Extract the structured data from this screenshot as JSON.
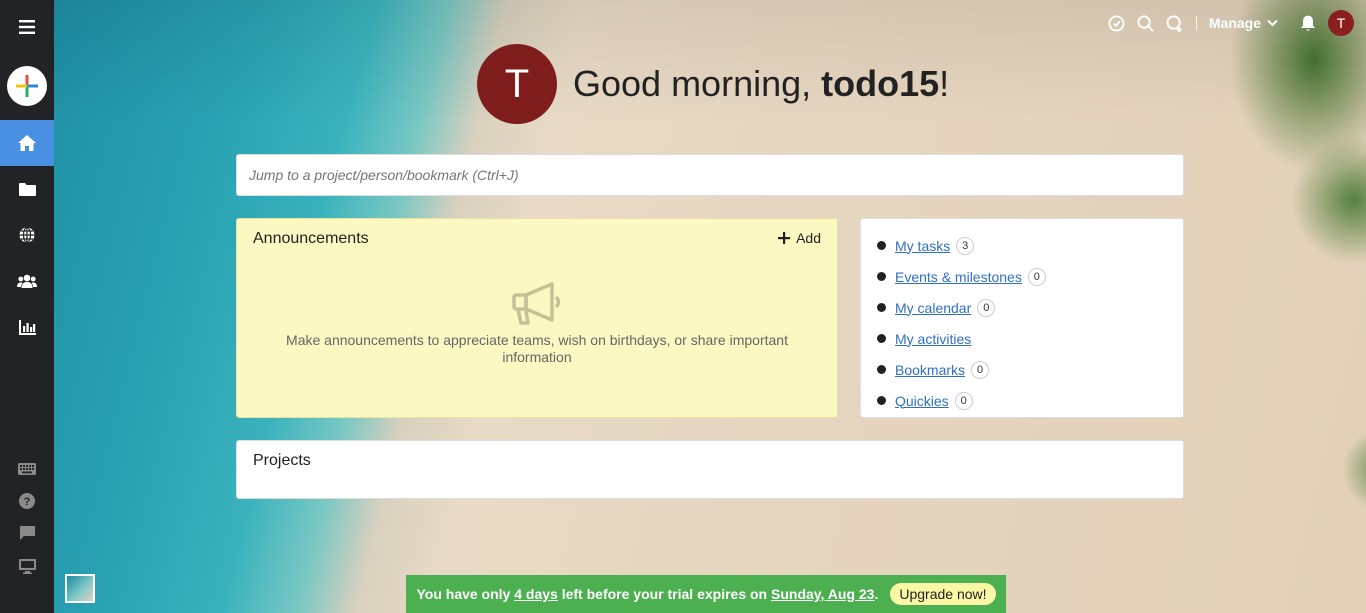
{
  "greeting": {
    "prefix": "Good morning, ",
    "username": "todo15",
    "suffix": "!",
    "avatar_letter": "T"
  },
  "topbar": {
    "manage_label": "Manage",
    "avatar_letter": "T"
  },
  "jump": {
    "placeholder": "Jump to a project/person/bookmark (Ctrl+J)"
  },
  "announcements": {
    "title": "Announcements",
    "add_label": "Add",
    "empty_message": "Make announcements to appreciate teams, wish on birthdays, or share important information"
  },
  "quick_links": [
    {
      "label": "My tasks",
      "count": "3"
    },
    {
      "label": "Events & milestones",
      "count": "0"
    },
    {
      "label": "My calendar",
      "count": "0"
    },
    {
      "label": "My activities",
      "count": null
    },
    {
      "label": "Bookmarks",
      "count": "0"
    },
    {
      "label": "Quickies",
      "count": "0"
    }
  ],
  "projects": {
    "title": "Projects"
  },
  "trial": {
    "pre": "You have only ",
    "days": "4 days",
    "mid": " left before your trial expires on ",
    "date": "Sunday, Aug 23",
    "post": ".",
    "upgrade_label": "Upgrade now!"
  },
  "colors": {
    "accent": "#4a90e2",
    "avatar": "#7f1d1d",
    "banner": "#4caf50",
    "announce_bg": "#fbf8c1"
  }
}
